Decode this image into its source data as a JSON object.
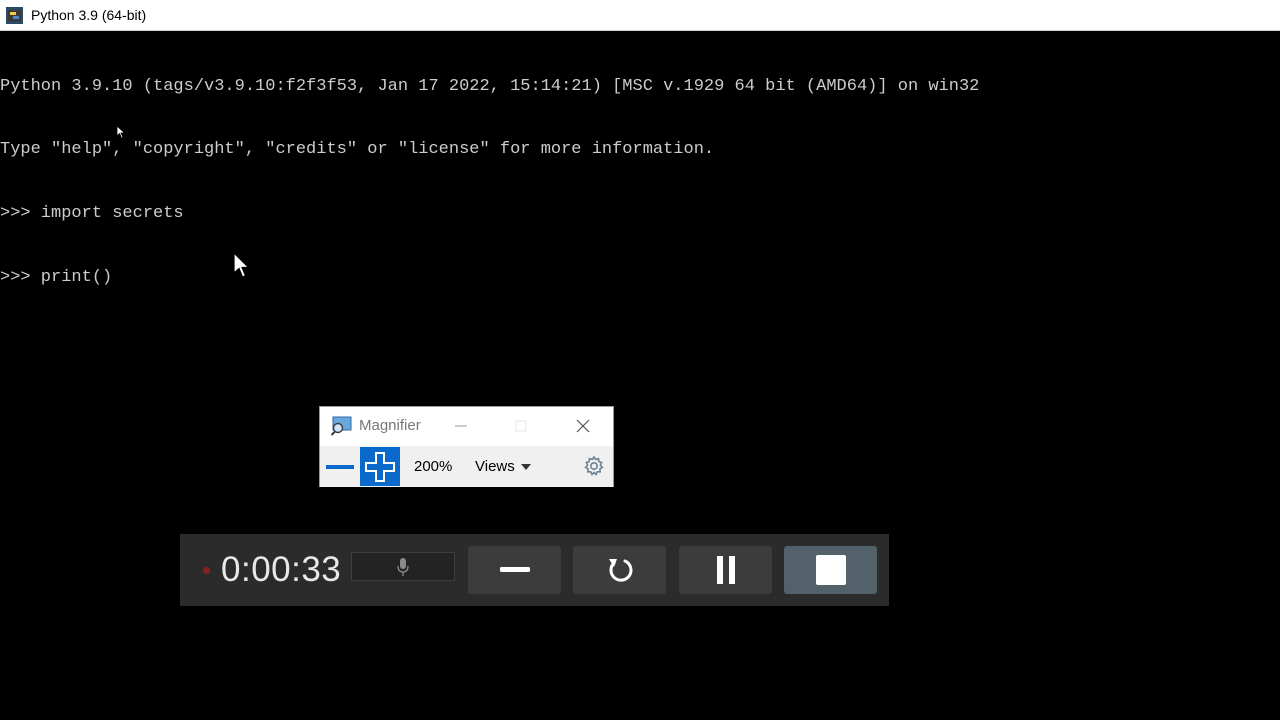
{
  "window": {
    "title": "Python 3.9 (64-bit)"
  },
  "console": {
    "lines": [
      "Python 3.9.10 (tags/v3.9.10:f2f3f53, Jan 17 2022, 15:14:21) [MSC v.1929 64 bit (AMD64)] on win32",
      "Type \"help\", \"copyright\", \"credits\" or \"license\" for more information.",
      ">>> import secrets",
      ">>> print()"
    ]
  },
  "magnifier": {
    "title": "Magnifier",
    "zoom_level": "200%",
    "views_label": "Views",
    "accent_color": "#0a6acb"
  },
  "recorder": {
    "elapsed": "0:00:33",
    "icons": [
      "record-indicator-icon",
      "microphone-icon",
      "minimize-icon",
      "restart-icon",
      "pause-icon",
      "stop-icon"
    ]
  }
}
